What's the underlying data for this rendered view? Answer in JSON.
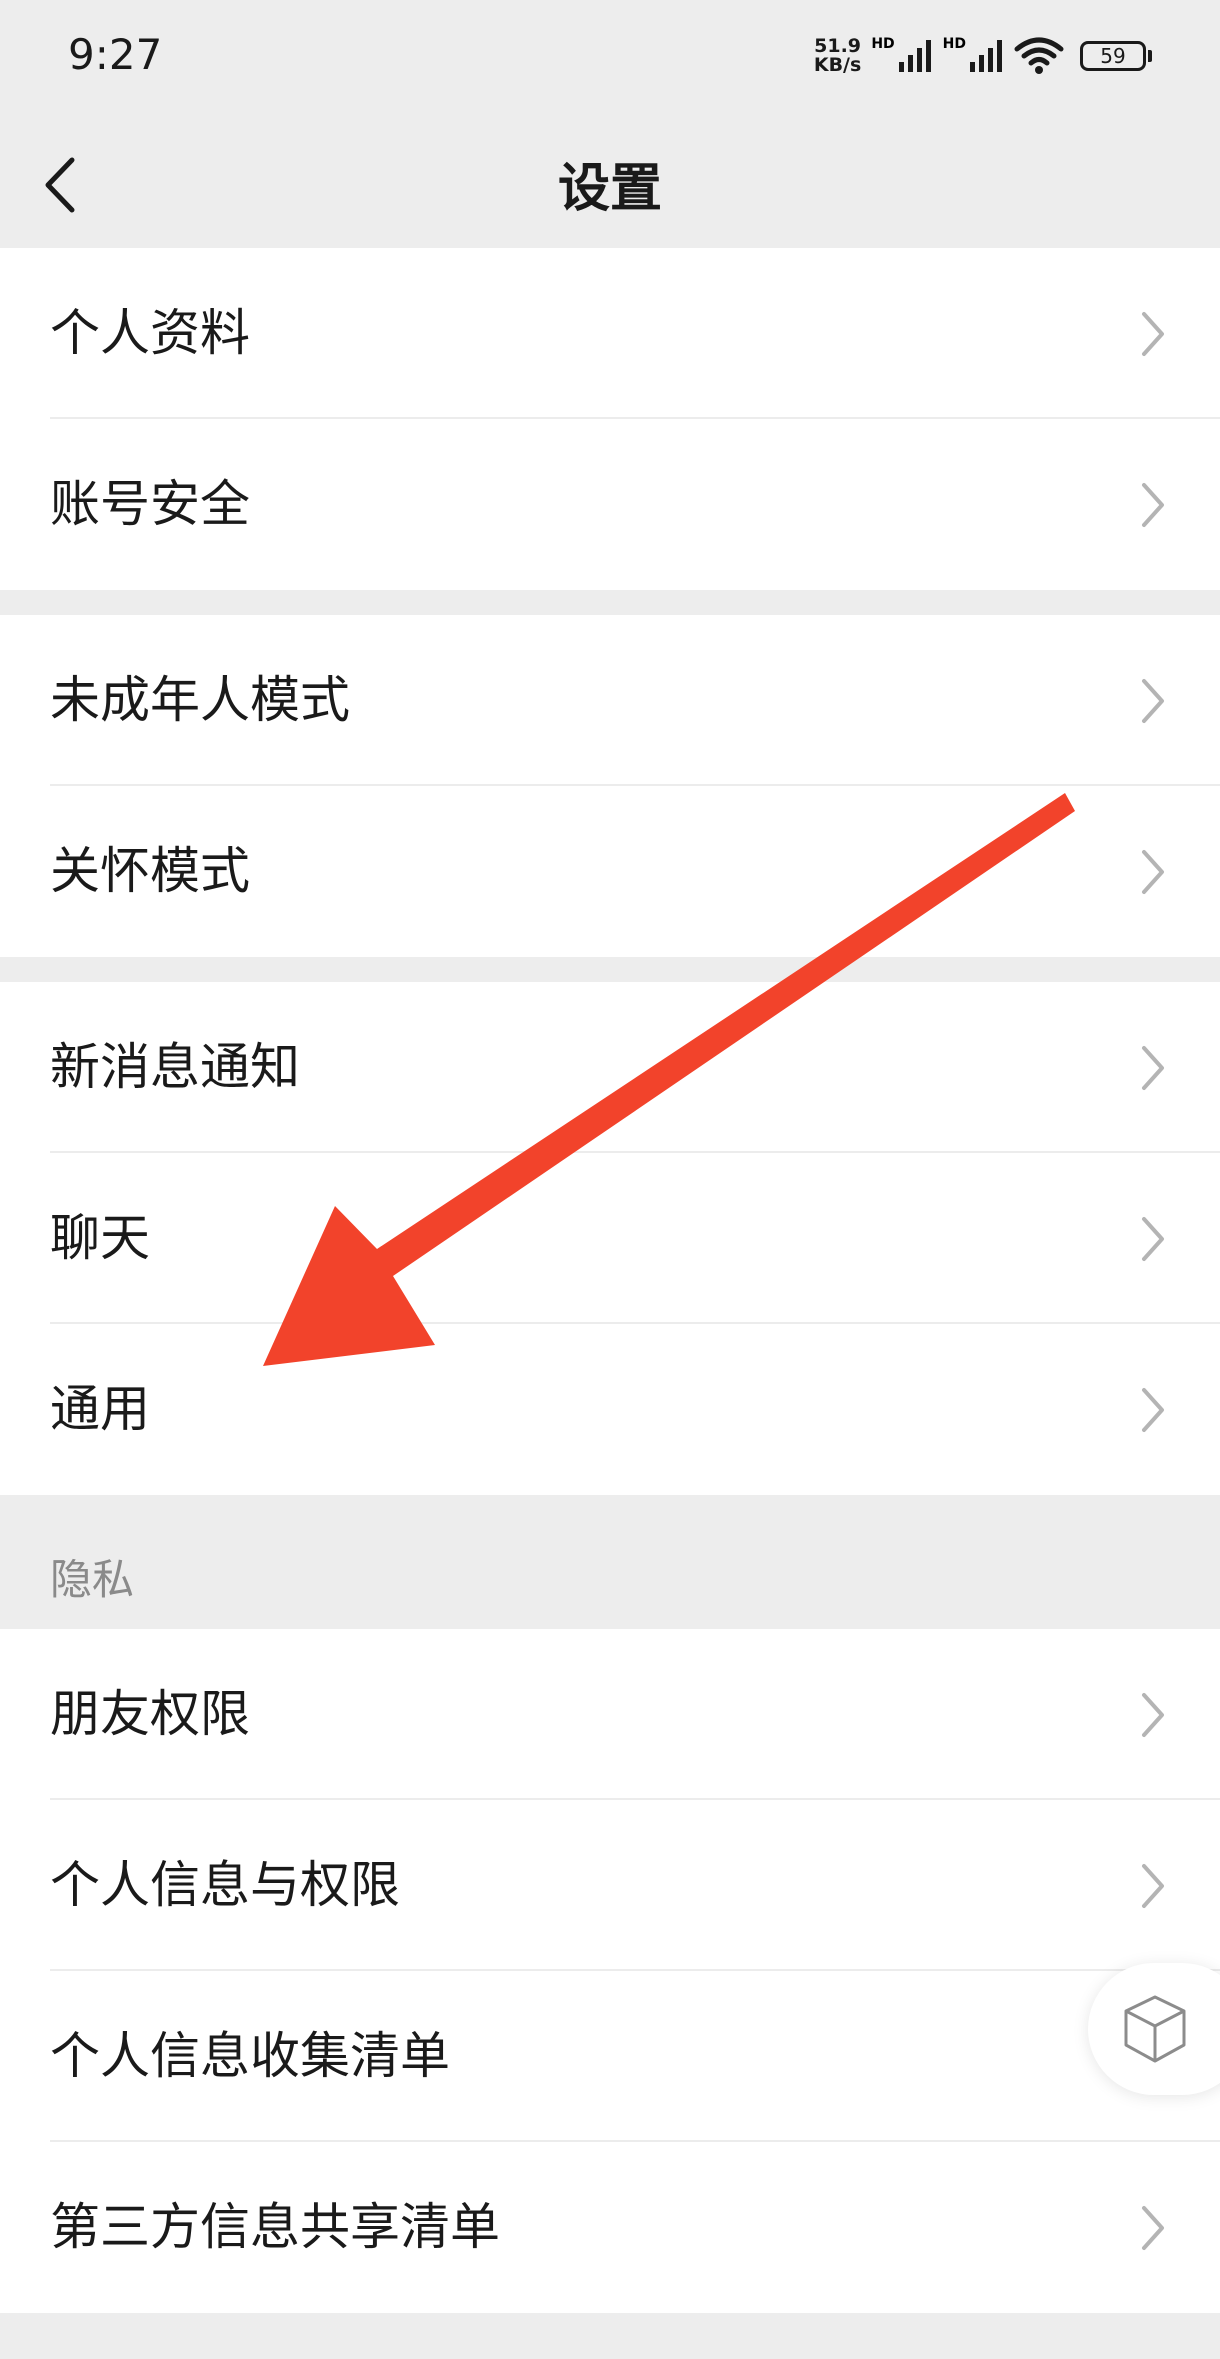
{
  "status_bar": {
    "time": "9:27",
    "net_speed_value": "51.9",
    "net_speed_unit": "KB/s",
    "sim1_hd": "HD",
    "sim2_hd": "HD",
    "battery": "59"
  },
  "nav": {
    "title": "设置",
    "back_icon": "chevron-left-icon"
  },
  "groups": [
    {
      "items": [
        {
          "label": "个人资料"
        },
        {
          "label": "账号安全"
        }
      ]
    },
    {
      "items": [
        {
          "label": "未成年人模式"
        },
        {
          "label": "关怀模式"
        }
      ]
    },
    {
      "items": [
        {
          "label": "新消息通知"
        },
        {
          "label": "聊天"
        },
        {
          "label": "通用"
        }
      ]
    },
    {
      "header": "隐私",
      "items": [
        {
          "label": "朋友权限"
        },
        {
          "label": "个人信息与权限"
        },
        {
          "label": "个人信息收集清单"
        },
        {
          "label": "第三方信息共享清单"
        }
      ]
    }
  ],
  "annotation": {
    "type": "arrow",
    "color": "#f2432b",
    "points_to": "通用"
  },
  "floating_button": {
    "icon": "cube-icon"
  },
  "colors": {
    "background": "#ededed",
    "card": "#ffffff",
    "text": "#1a1a1a",
    "chevron": "#b4b4b4",
    "section_header": "#8a8a8a"
  }
}
